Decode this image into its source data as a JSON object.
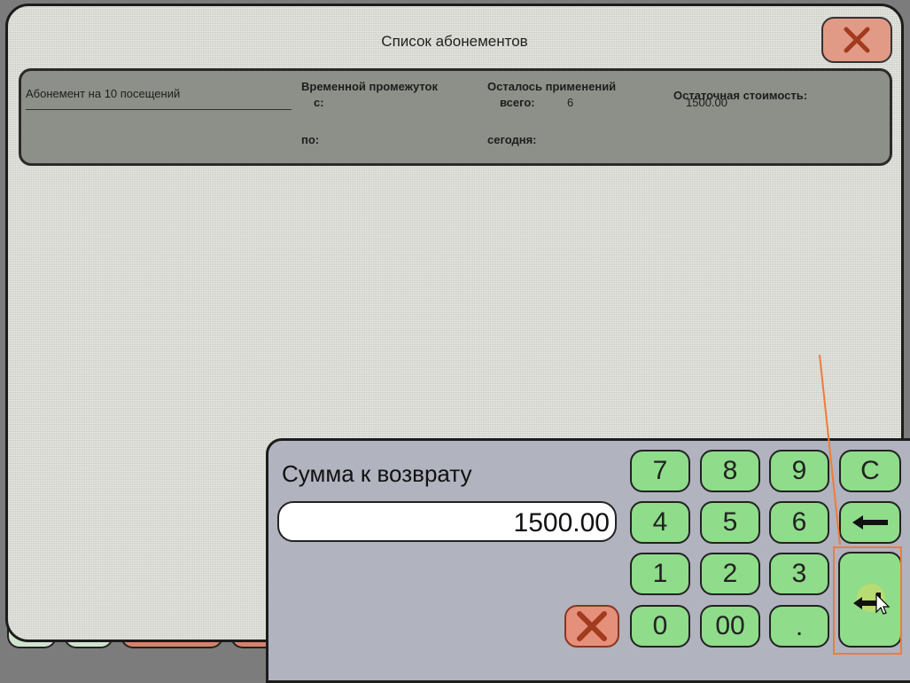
{
  "window": {
    "title": "Список абонементов",
    "close_icon": "close-x-icon"
  },
  "subscription": {
    "name": "Абонемент на 10 посещений",
    "period_label": "Временной промежуток",
    "from_label": "с:",
    "to_label": "по:",
    "remaining_label": "Осталось применений",
    "total_label": "всего:",
    "total_value": "6",
    "today_label": "сегодня:",
    "residual_label": "Остаточная стоимость:",
    "residual_value": "1500.00"
  },
  "refund": {
    "title": "Сумма к возврату",
    "amount": "1500.00",
    "keys": [
      "7",
      "8",
      "9",
      "C",
      "4",
      "5",
      "6",
      "1",
      "2",
      "3",
      "0",
      "00",
      "."
    ],
    "backspace_icon": "arrow-left-icon",
    "enter_icon": "enter-return-icon",
    "cancel_icon": "close-x-icon"
  },
  "colors": {
    "key_green": "#8fdc8a",
    "cancel_red": "#e5907a",
    "panel": "#b1b3bf",
    "focus_orange": "#f07b3a"
  }
}
